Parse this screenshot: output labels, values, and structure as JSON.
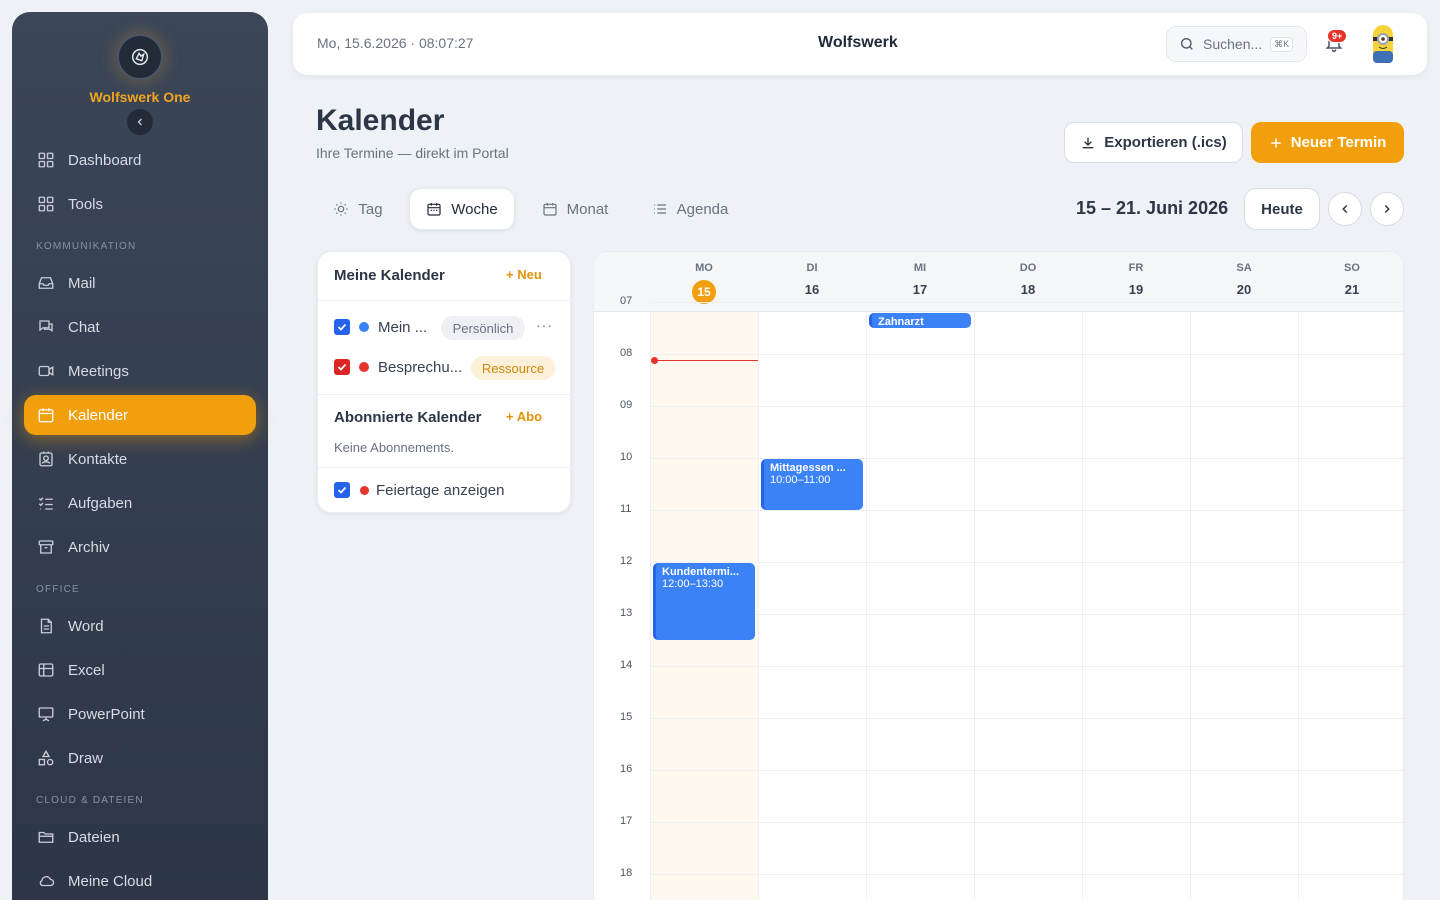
{
  "sidebar": {
    "brand": "Wolfswerk One",
    "sections": {
      "kommunikation": "KOMMUNIKATION",
      "office": "OFFICE",
      "cloud": "CLOUD & DATEIEN"
    },
    "items": [
      {
        "label": "Dashboard",
        "icon": "grid-icon"
      },
      {
        "label": "Tools",
        "icon": "grid-icon"
      },
      {
        "label": "Mail",
        "icon": "inbox-icon"
      },
      {
        "label": "Chat",
        "icon": "chat-icon"
      },
      {
        "label": "Meetings",
        "icon": "video-icon"
      },
      {
        "label": "Kalender",
        "icon": "calendar-icon",
        "active": true
      },
      {
        "label": "Kontakte",
        "icon": "contact-icon"
      },
      {
        "label": "Aufgaben",
        "icon": "tasks-icon"
      },
      {
        "label": "Archiv",
        "icon": "archive-icon"
      },
      {
        "label": "Word",
        "icon": "document-icon"
      },
      {
        "label": "Excel",
        "icon": "table-icon"
      },
      {
        "label": "PowerPoint",
        "icon": "presentation-icon"
      },
      {
        "label": "Draw",
        "icon": "shapes-icon"
      },
      {
        "label": "Dateien",
        "icon": "folder-icon"
      },
      {
        "label": "Meine Cloud",
        "icon": "cloud-icon"
      }
    ]
  },
  "topbar": {
    "datetime": "Mo, 15.6.2026 · 08:07:27",
    "app_name": "Wolfswerk",
    "search_placeholder": "Suchen...",
    "search_shortcut": "⌘K",
    "notifications_badge": "9+"
  },
  "page": {
    "title": "Kalender",
    "subtitle": "Ihre Termine — direkt im Portal",
    "export_label": "Exportieren (.ics)",
    "new_label": "Neuer Termin"
  },
  "views": {
    "tabs": [
      {
        "label": "Tag",
        "icon": "sun-icon"
      },
      {
        "label": "Woche",
        "icon": "calendar-icon",
        "active": true
      },
      {
        "label": "Monat",
        "icon": "calendar-icon"
      },
      {
        "label": "Agenda",
        "icon": "list-icon"
      }
    ],
    "range_label": "15 – 21. Juni 2026",
    "today_label": "Heute"
  },
  "calendars": {
    "my_title": "Meine Kalender",
    "my_add": "Neu",
    "items": [
      {
        "name": "Mein ...",
        "tag": "Persönlich",
        "color": "#3b82f6",
        "checked": true
      },
      {
        "name": "Besprechu...",
        "tag": "Ressource",
        "color": "#e5342b",
        "checked": true
      }
    ],
    "subscribed_title": "Abonnierte Kalender",
    "subscribed_add": "Abo",
    "subscribed_empty": "Keine Abonnements.",
    "holidays_label": "Feiertage anzeigen",
    "holidays_checked": true
  },
  "week": {
    "days": [
      {
        "name": "MO",
        "date": "15",
        "today": true
      },
      {
        "name": "DI",
        "date": "16"
      },
      {
        "name": "MI",
        "date": "17"
      },
      {
        "name": "DO",
        "date": "18"
      },
      {
        "name": "FR",
        "date": "19"
      },
      {
        "name": "SA",
        "date": "20"
      },
      {
        "name": "SO",
        "date": "21"
      }
    ],
    "hours": [
      "07",
      "08",
      "09",
      "10",
      "11",
      "12",
      "13",
      "14",
      "15",
      "16",
      "17",
      "18"
    ],
    "now": "08:07",
    "events": [
      {
        "title": "Zahnarzt",
        "time": "",
        "day": "MI",
        "start": "07:00",
        "end": "07:30"
      },
      {
        "title": "Mittagessen ...",
        "time": "10:00–11:00",
        "day": "DI",
        "start": "10:00",
        "end": "11:00"
      },
      {
        "title": "Kundentermi...",
        "time": "12:00–13:30",
        "day": "MO",
        "start": "12:00",
        "end": "13:30"
      }
    ]
  }
}
